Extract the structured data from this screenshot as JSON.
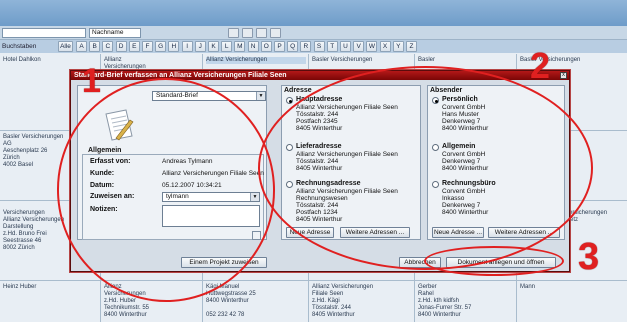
{
  "toolbar": {
    "name_field": "",
    "name_selector": "Nachname",
    "buchstaben_label": "Buchstaben",
    "alpha_all": "Alle",
    "letters": [
      "A",
      "B",
      "C",
      "D",
      "E",
      "F",
      "G",
      "H",
      "I",
      "J",
      "K",
      "L",
      "M",
      "N",
      "O",
      "P",
      "Q",
      "R",
      "S",
      "T",
      "U",
      "V",
      "W",
      "X",
      "Y",
      "Z"
    ]
  },
  "grid": {
    "row1": [
      {
        "text": "Hotel Dahlkon"
      },
      {
        "text": "Allianz\nVersicherungen"
      },
      {
        "text": "Allianz Versicherungen"
      },
      {
        "text": "Basler Versicherungen"
      },
      {
        "text": "Basler"
      },
      {
        "text": "Basler Versicherungen"
      }
    ],
    "row2": [
      {
        "text": "Basler Versicherungen\nAG\nAeschenplatz 26\nZürich\n4002 Basel"
      }
    ],
    "row3": [
      {
        "text": "Versicherungen"
      },
      {
        "text": "Allianz Versicherungen\nDarstellung\nz.Hd. Bruno Frei\nSeestrasse 46\n8002 Zürich"
      },
      {
        "text": "versicherungen\nPetz"
      }
    ],
    "row4": [
      {
        "text": "Heinz Huber"
      },
      {
        "text": "Allianz\nVersicherungen\nz.Hd. Huber\nTechnikumstr. 55\n8400 Winterthur"
      },
      {
        "text": "Kägi Manuel\nHuttwegstrasse 25\n8400 Winterthur\n\n052 232 42 78"
      },
      {
        "text": "Allianz Versicherungen\nFiliale Seen\nz.Hd. Kägi\nTösstalstr. 244\n8405 Winterthur"
      },
      {
        "text": "Gerber\nRahel\nz.Hd. kth kidfsh\nJonas-Furrer Str. 57\n8400 Winterthur"
      },
      {
        "text": "Mann"
      }
    ]
  },
  "dialog": {
    "title": "Standard-Brief verfassen an Allianz Versicherungen Filiale Seen",
    "close": "x",
    "template_select": "Standard-Brief",
    "allgemein": {
      "title": "Allgemein",
      "erfasst_label": "Erfasst von:",
      "erfasst_value": "Andreas Tylmann",
      "kunde_label": "Kunde:",
      "kunde_value": "Allianz Versicherungen Filiale Seen",
      "datum_label": "Datum:",
      "datum_value": "05.12.2007 10:34:21",
      "zuweisen_label": "Zuweisen an:",
      "zuweisen_value": "tylmann",
      "notizen_label": "Notizen:"
    },
    "project_button": "Einem Projekt zuweisen",
    "adresse": {
      "title": "Adresse",
      "haupt_title": "Hauptadresse",
      "haupt_lines": [
        "Allianz Versicherungen Filiale Seen",
        "Tösstalstr. 244",
        "Postfach 2345",
        "8405 Winterthur"
      ],
      "liefer_title": "Lieferadresse",
      "liefer_lines": [
        "Allianz Versicherungen Filiale Seen",
        "Tösstalstr. 244",
        "8405 Winterthur"
      ],
      "rechnung_title": "Rechnungsadresse",
      "rechnung_lines": [
        "Allianz Versicherungen Filiale Seen",
        "Rechnungswesen",
        "Tösstalstr. 244",
        "Postfach 1234",
        "8405 Winterthur"
      ],
      "new_button": "Neue Adresse",
      "more_button": "Weitere Adressen ..."
    },
    "absender": {
      "title": "Absender",
      "pers_title": "Persönlich",
      "pers_lines": [
        "Corvent GmbH",
        "Hans Muster",
        "Denkerweg 7",
        "8400 Winterthur"
      ],
      "allg_title": "Allgemein",
      "allg_lines": [
        "Corvent GmbH",
        "Denkerweg 7",
        "8400 Winterthur"
      ],
      "rech_title": "Rechnungsbüro",
      "rech_lines": [
        "Corvent GmbH",
        "Inkasso",
        "Denkerweg 7",
        "8400 Winterthur"
      ],
      "new_button": "Neue Adresse ...",
      "more_button": "Weitere Adressen ..."
    },
    "cancel_button": "Abbrechen",
    "create_button": "Dokument anlegen und öffnen"
  },
  "annotations": {
    "one": "1",
    "two": "2",
    "three": "3",
    "color": "#e02020"
  }
}
